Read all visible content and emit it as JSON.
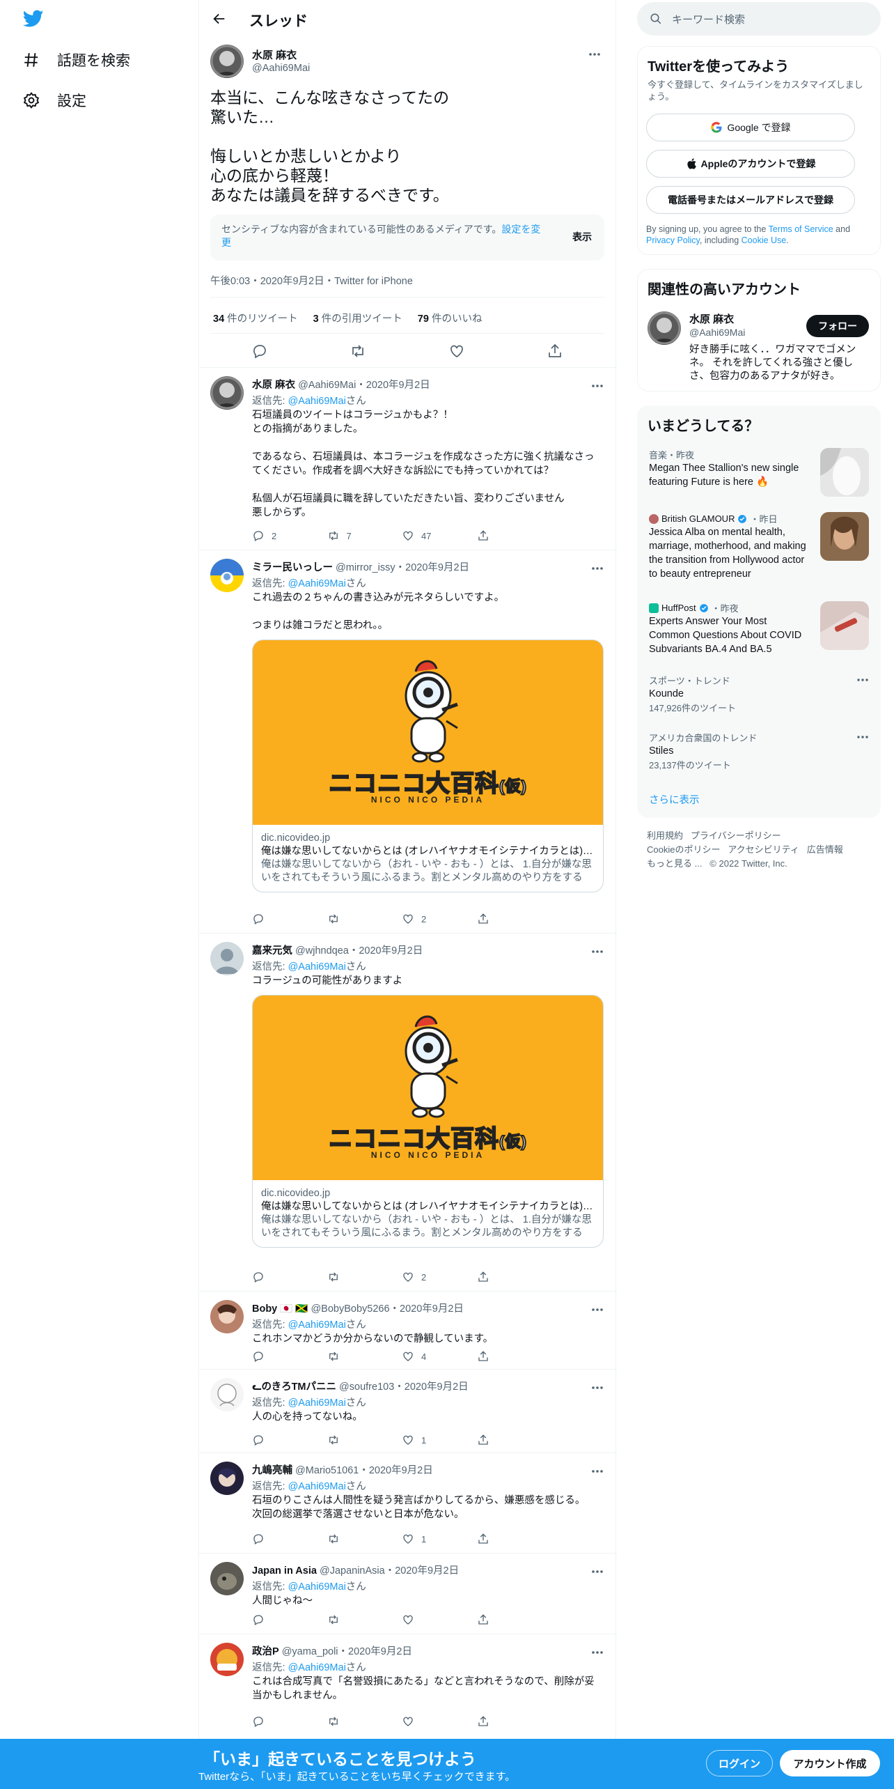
{
  "nav": {
    "explore": "話題を検索",
    "settings": "設定"
  },
  "header": {
    "title": "スレッド"
  },
  "main_tweet": {
    "name": "水原 麻衣",
    "handle": "@Aahi69Mai",
    "text": "本当に、こんな呟きなさってたの\n驚いた…\n\n悔しいとか悲しいとかより\n心の底から軽蔑！\nあなたは議員を辞するべきです。",
    "sensitive_text": "センシティブな内容が含まれている可能性のあるメディアです。",
    "sensitive_link": "設定を変更",
    "show_label": "表示",
    "timestamp": "午後0:03・2020年9月2日・Twitter for iPhone",
    "retweets_num": "34",
    "retweets_label": "件のリツイート",
    "quotes_num": "3",
    "quotes_label": "件の引用ツイート",
    "likes_num": "79",
    "likes_label": "件のいいね"
  },
  "reply_prefix": "返信先: ",
  "reply_suffix": "さん",
  "replies": [
    {
      "name": "水原 麻衣",
      "handle": "@Aahi69Mai",
      "date": "2020年9月2日",
      "to": "@Aahi69Mai",
      "text": "石垣議員のツイートはコラージュかもよ？！\nとの指摘がありました。\n\nであるなら、石垣議員は、本コラージュを作成なさった方に強く抗議なさってください。作成者を調べ大好きな訴訟にでも持っていかれては？\n\n私個人が石垣議員に職を辞していただきたい旨、変わりございません\n悪しからず。",
      "replies": "2",
      "retweets": "7",
      "likes": "47"
    },
    {
      "name": "ミラー民いっしー",
      "handle": "@mirror_issy",
      "date": "2020年9月2日",
      "to": "@Aahi69Mai",
      "text": "これ過去の２ちゃんの書き込みが元ネタらしいですよ。\n\nつまりは雑コラだと思われ。。",
      "card_domain": "dic.nicovideo.jp",
      "card_title": "俺は嫌な思いしてないからとは (オレハイヤナオモイシテナイカラとは) [単語記事]",
      "card_desc": "俺は嫌な思いしてないから（おれ - いや - おも - ）とは、 1.自分が嫌な思いをされてもそういう風にふるまう。割とメンタル高めのやり方をする人。",
      "card_logo": "ニコニコ大百科",
      "card_logo_sub": "(仮)",
      "card_logo_en": "NICO NICO PEDIA",
      "replies": "",
      "retweets": "",
      "likes": "2"
    },
    {
      "name": "嘉来元気",
      "handle": "@wjhndqea",
      "date": "2020年9月2日",
      "to": "@Aahi69Mai",
      "text": "コラージュの可能性がありますよ",
      "card_domain": "dic.nicovideo.jp",
      "card_title": "俺は嫌な思いしてないからとは (オレハイヤナオモイシテナイカラとは) [単語記事]",
      "card_desc": "俺は嫌な思いしてないから（おれ - いや - おも - ）とは、 1.自分が嫌な思いをされてもそういう風にふるまう。割とメンタル高めのやり方をする人。",
      "card_logo": "ニコニコ大百科",
      "card_logo_sub": "(仮)",
      "card_logo_en": "NICO NICO PEDIA",
      "replies": "",
      "retweets": "",
      "likes": "2"
    },
    {
      "name": "Boby 🇯🇵 🇯🇲",
      "handle": "@BobyBoby5266",
      "date": "2020年9月2日",
      "to": "@Aahi69Mai",
      "text": "これホンマかどうか分からないので静観しています。",
      "replies": "",
      "retweets": "",
      "likes": "4"
    },
    {
      "name": "ᓚのきろTMパニニ",
      "handle": "@soufre103",
      "date": "2020年9月2日",
      "to": "@Aahi69Mai",
      "text": "人の心を持ってないね。",
      "replies": "",
      "retweets": "",
      "likes": "1"
    },
    {
      "name": "九嶋亮輔",
      "handle": "@Mario51061",
      "date": "2020年9月2日",
      "to": "@Aahi69Mai",
      "text": "石垣のりこさんは人間性を疑う発言ばかりしてるから、嫌悪感を感じる。\n次回の総選挙で落選させないと日本が危ない。",
      "replies": "",
      "retweets": "",
      "likes": "1"
    },
    {
      "name": "Japan in Asia",
      "handle": "@JapaninAsia",
      "date": "2020年9月2日",
      "to": "@Aahi69Mai",
      "text": "人間じゃね〜",
      "replies": "",
      "retweets": "",
      "likes": ""
    },
    {
      "name": "政治P",
      "handle": "@yama_poli",
      "date": "2020年9月2日",
      "to": "@Aahi69Mai",
      "text": "これは合成写真で「名誉毀損にあたる」などと言われそうなので、削除が妥当かもしれません。",
      "replies": "",
      "retweets": "",
      "likes": ""
    }
  ],
  "search": {
    "placeholder": "キーワード検索"
  },
  "signup": {
    "title": "Twitterを使ってみよう",
    "subtitle": "今すぐ登録して、タイムラインをカスタマイズしましょう。",
    "google": "Google で登録",
    "apple": "Appleのアカウントで登録",
    "phone": "電話番号またはメールアドレスで登録",
    "terms_pre": "By signing up, you agree to the ",
    "terms_link": "Terms of Service",
    "terms_and": " and ",
    "privacy_link": "Privacy Policy",
    "terms_including": ", including ",
    "cookie_link": "Cookie Use",
    "terms_end": "."
  },
  "related": {
    "title": "関連性の高いアカウント",
    "name": "水原 麻衣",
    "handle": "@Aahi69Mai",
    "follow": "フォロー",
    "bio": "好き勝手に呟く．．ワガママでゴメンネ。 それを許してくれる強さと優しさ、包容力のあるアナタが好き。"
  },
  "trends": {
    "title": "いまどうしてる？",
    "items": [
      {
        "category": "音楽・昨夜",
        "title": "Megan Thee Stallion's new single featuring Future is here 🔥"
      },
      {
        "source": "British GLAMOUR",
        "time": "・昨日",
        "title": "Jessica Alba on mental health, marriage, motherhood, and making the transition from Hollywood actor to beauty entrepreneur"
      },
      {
        "source": "HuffPost",
        "time": "・昨夜",
        "title": "Experts Answer Your Most Common Questions About COVID Subvariants BA.4 And BA.5"
      },
      {
        "category": "スポーツ・トレンド",
        "title": "Kounde",
        "count": "147,926件のツイート"
      },
      {
        "category": "アメリカ合衆国のトレンド",
        "title": "Stiles",
        "count": "23,137件のツイート"
      }
    ],
    "more": "さらに表示"
  },
  "footer": {
    "terms": "利用規約",
    "privacy": "プライバシーポリシー",
    "cookie": "Cookieのポリシー",
    "accessibility": "アクセシビリティ",
    "ads": "広告情報",
    "more": "もっと見る ...",
    "copyright": "© 2022 Twitter, Inc."
  },
  "bottom_bar": {
    "headline": "「いま」起きていることを見つけよう",
    "sub": "Twitterなら、「いま」起きていることをいち早くチェックできます。",
    "login": "ログイン",
    "signup": "アカウント作成"
  },
  "colors": {
    "accent": "#1d9bf0",
    "text": "#0f1419",
    "secondary": "#536471",
    "card_bg": "#fbae1d"
  }
}
